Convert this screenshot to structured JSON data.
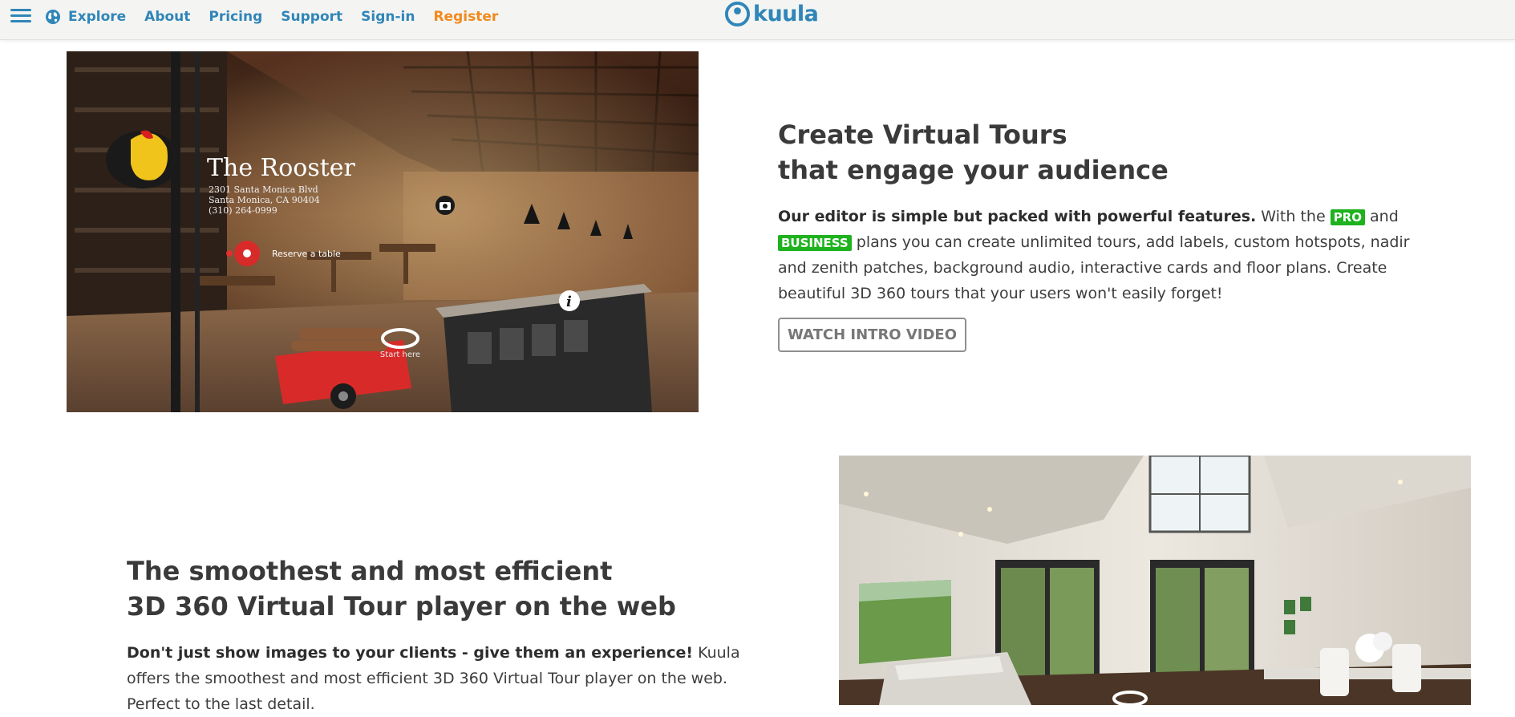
{
  "nav": {
    "menu_icon": "hamburger-menu-icon",
    "explore": "Explore",
    "about": "About",
    "pricing": "Pricing",
    "support": "Support",
    "signin": "Sign-in",
    "register": "Register"
  },
  "logo": {
    "text": "kuula"
  },
  "section1": {
    "image_overlay": {
      "venue": "The Rooster",
      "address_line1": "2301 Santa Monica Blvd",
      "address_line2": "Santa Monica, CA 90404",
      "phone": "(310) 264-0999",
      "reserve": "Reserve a table",
      "start": "Start here"
    },
    "heading_line1": "Create Virtual Tours",
    "heading_line2": "that engage your audience",
    "bold_lead": "Our editor is simple but packed with powerful features.",
    "text_a": " With the ",
    "badge_pro": "PRO",
    "text_b": " and ",
    "badge_business": "BUSINESS",
    "text_c": " plans you can create unlimited tours, add labels, custom hotspots, nadir and zenith patches, background audio, interactive cards and floor plans. Create beautiful 3D 360 tours that your users won't easily forget!",
    "button": "WATCH INTRO VIDEO"
  },
  "section2": {
    "heading_line1": "The smoothest and most efficient",
    "heading_line2": "3D 360 Virtual Tour player on the web",
    "bold_lead": "Don't just show images to your clients - give them an experience!",
    "text": " Kuula offers the smoothest and most efficient 3D 360 Virtual Tour player on the web. Perfect to the last detail."
  },
  "colors": {
    "link": "#2f86b8",
    "register": "#f08a1c",
    "badge": "#1fb21f"
  }
}
